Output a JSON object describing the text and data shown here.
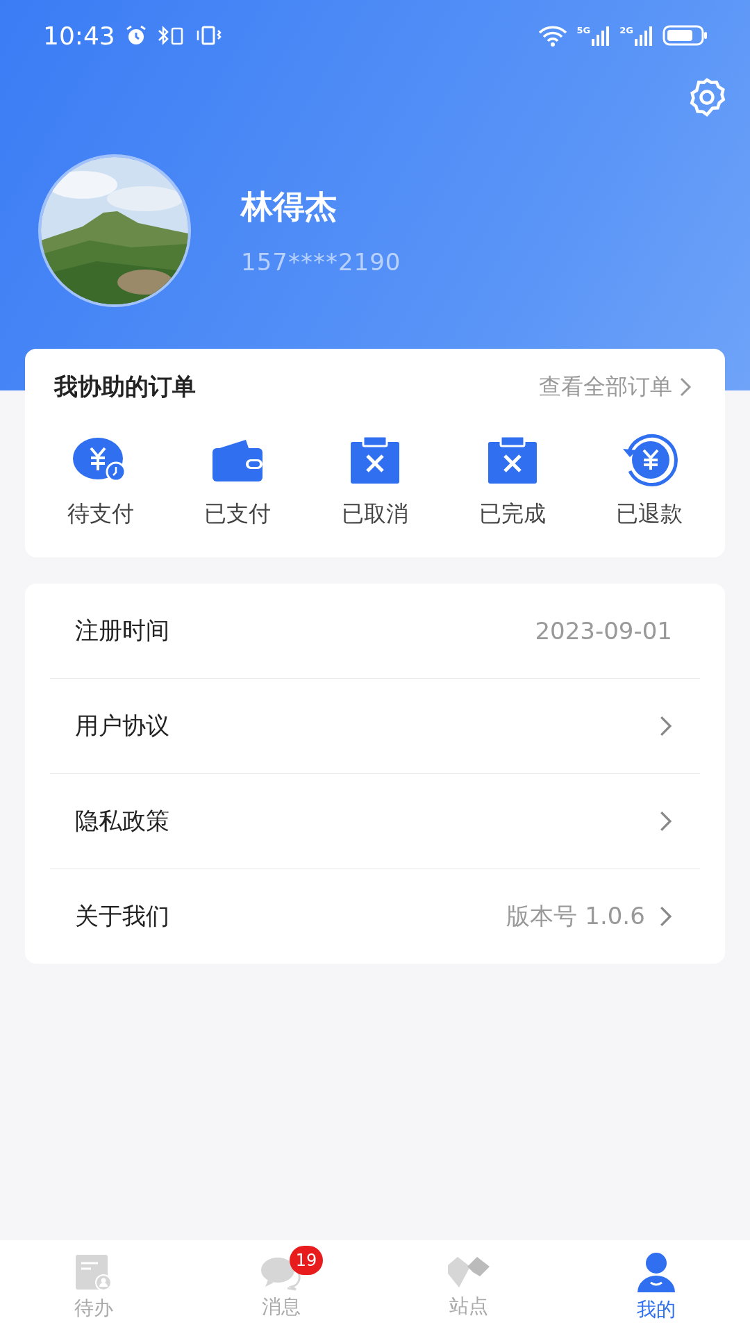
{
  "status_bar": {
    "time": "10:43",
    "networks": [
      "5G",
      "2G"
    ]
  },
  "profile": {
    "name": "林得杰",
    "phone": "157****2190"
  },
  "orders": {
    "title": "我协助的订单",
    "view_all": "查看全部订单",
    "items": [
      {
        "label": "待支付",
        "kind": "pending"
      },
      {
        "label": "已支付",
        "kind": "wallet"
      },
      {
        "label": "已取消",
        "kind": "clipboard"
      },
      {
        "label": "已完成",
        "kind": "clipboard"
      },
      {
        "label": "已退款",
        "kind": "refund"
      }
    ]
  },
  "menu": [
    {
      "label": "注册时间",
      "value": "2023-09-01",
      "arrow": false
    },
    {
      "label": "用户协议",
      "arrow": true
    },
    {
      "label": "隐私政策",
      "arrow": true
    },
    {
      "label": "关于我们",
      "value": "版本号 1.0.6",
      "arrow": true
    }
  ],
  "tabs": [
    {
      "label": "待办",
      "kind": "todo",
      "selected": false
    },
    {
      "label": "消息",
      "kind": "message",
      "badge": "19",
      "selected": false
    },
    {
      "label": "站点",
      "kind": "site",
      "selected": false
    },
    {
      "label": "我的",
      "kind": "me",
      "selected": true
    }
  ]
}
